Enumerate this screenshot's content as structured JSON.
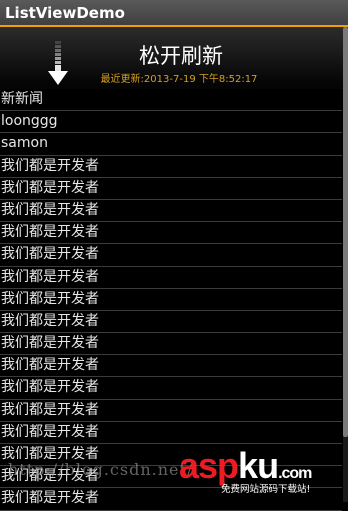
{
  "app": {
    "title": "ListViewDemo"
  },
  "refresh_header": {
    "label": "松开刷新",
    "last_update": "最近更新:2013-7-19 下午8:52:17"
  },
  "list_items": [
    "新新闻",
    "loonggg",
    "samon",
    "我们都是开发者",
    "我们都是开发者",
    "我们都是开发者",
    "我们都是开发者",
    "我们都是开发者",
    "我们都是开发者",
    "我们都是开发者",
    "我们都是开发者",
    "我们都是开发者",
    "我们都是开发者",
    "我们都是开发者",
    "我们都是开发者",
    "我们都是开发者",
    "我们都是开发者",
    "我们都是开发者",
    "我们都是开发者"
  ],
  "watermark": {
    "url_text": "http://blog.csdn.net/",
    "logo_part1": "asp",
    "logo_part2": "ku",
    "logo_suffix": ".com",
    "tagline": "免费网站源码下载站!"
  },
  "colors": {
    "title_bar_accent": "#f0a000",
    "update_time": "#d4a01f",
    "logo_red": "#ec1c24"
  },
  "icons": {
    "refresh_arrow": "arrow-down-icon"
  }
}
